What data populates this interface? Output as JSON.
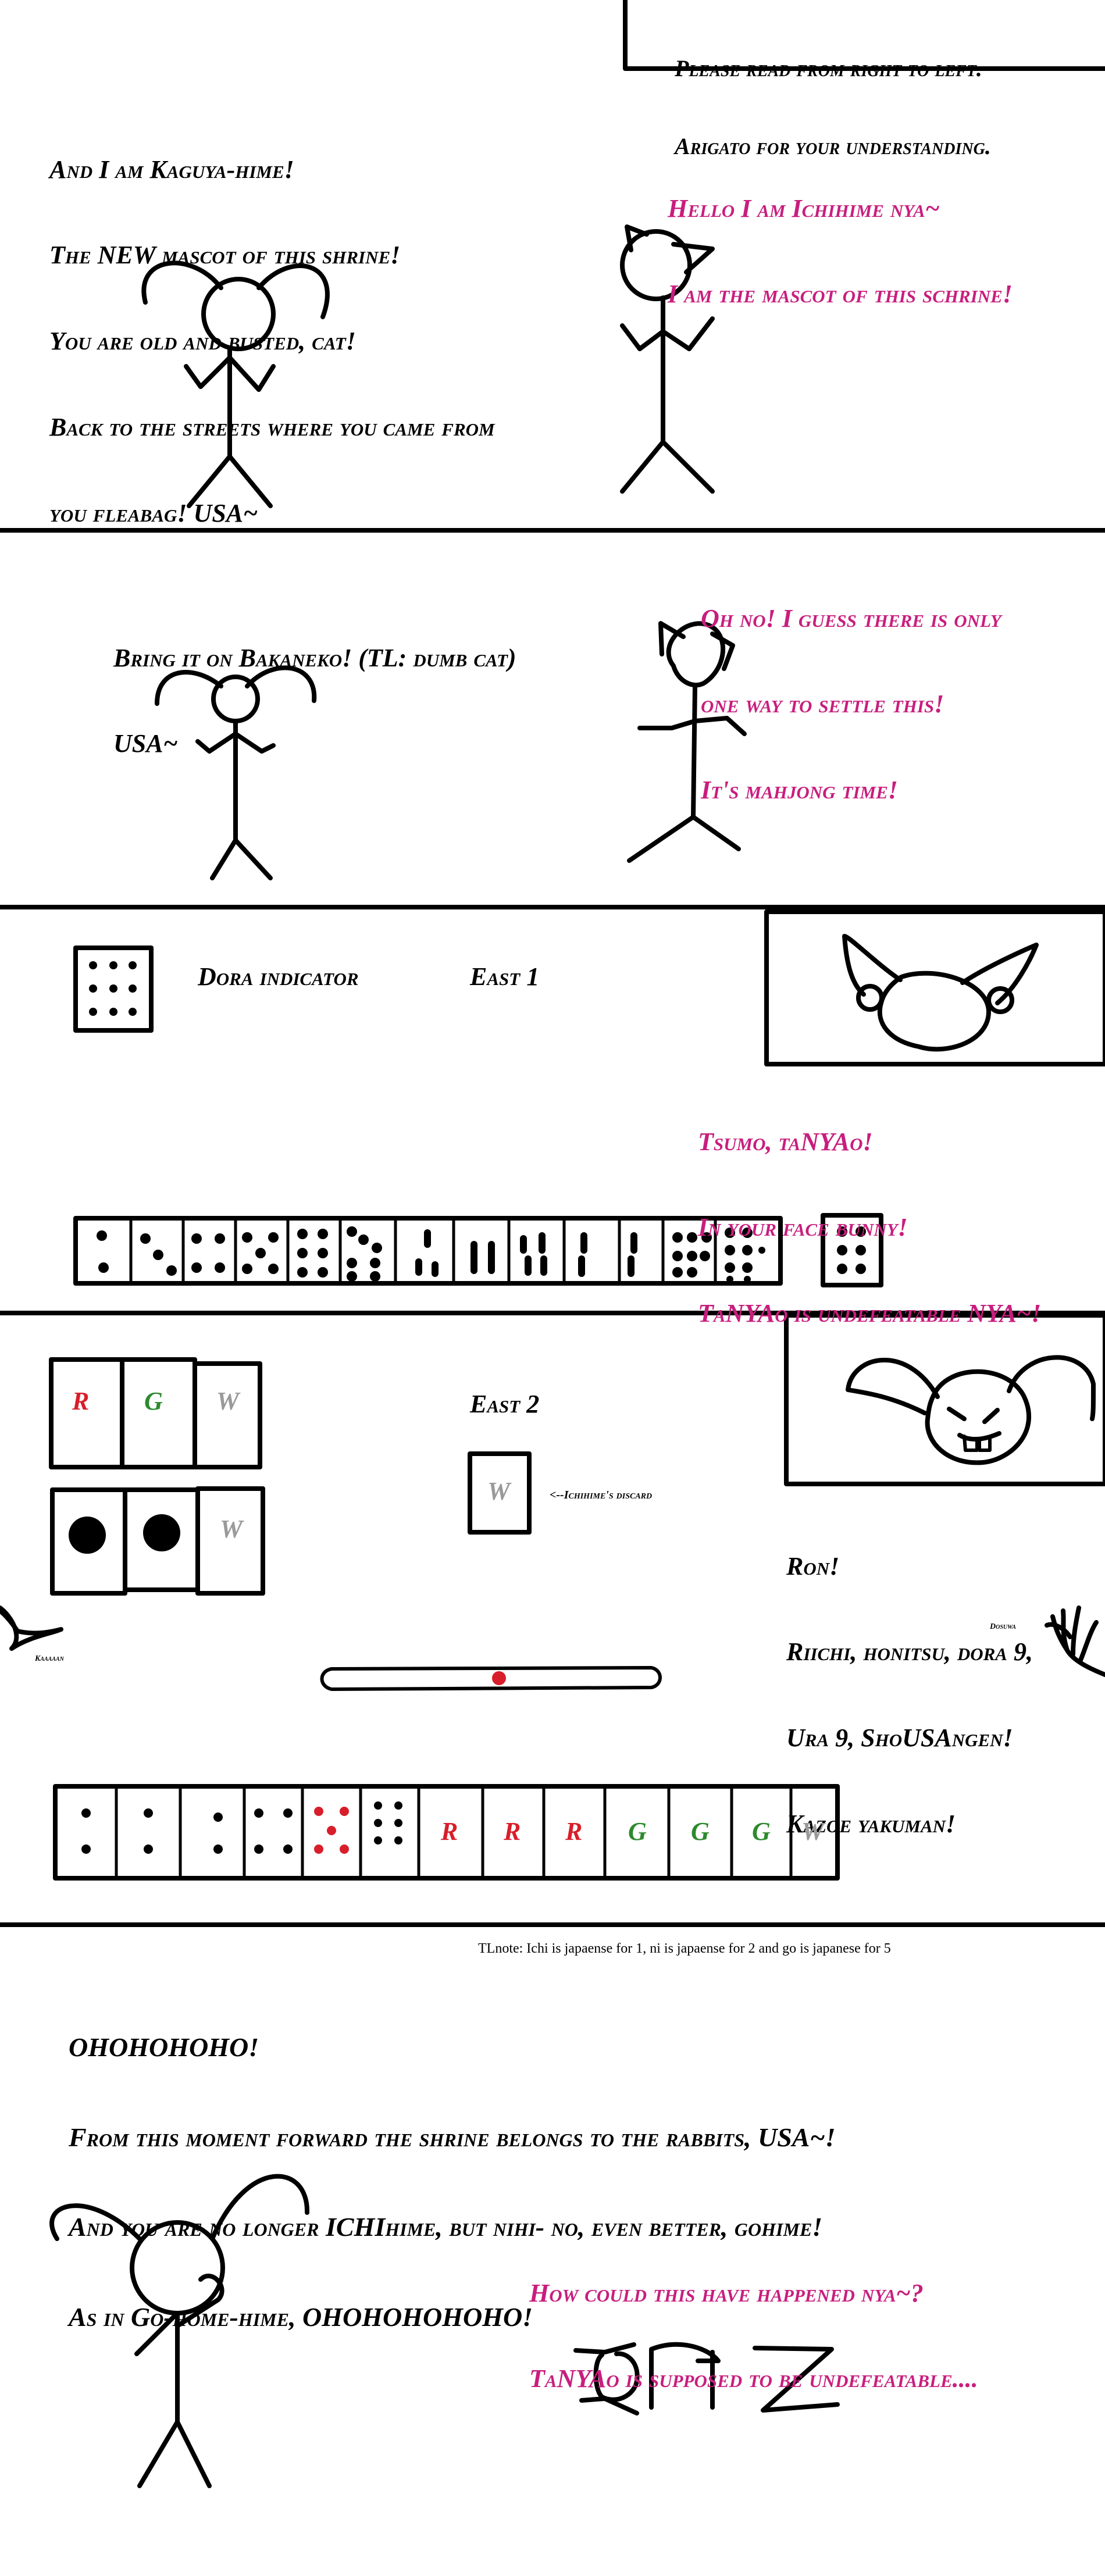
{
  "colors": {
    "ichihime": "#c81e7e",
    "red_tile": "#d81e2a",
    "green_tile": "#2d8a2d",
    "white_tile": "#9a9a9a"
  },
  "note": {
    "line1": "Please read from right to left.",
    "line2": "Arigato for your understanding."
  },
  "panel1": {
    "ichihime": [
      "Hello I am Ichihime nya~",
      "I am the mascot of this schrine!"
    ],
    "kaguya": [
      "And I am Kaguya-hime!",
      "The NEW mascot of this shrine!",
      "You are old and busted, cat!",
      "Back to the streets where you came from",
      "you fleabag! USA~"
    ]
  },
  "panel2": {
    "ichihime": [
      "Oh no! I guess there is only",
      "one way to settle this!",
      "It's mahjong time!"
    ],
    "kaguya": [
      "Bring it on Bakaneko! (TL: dumb cat)",
      "USA~"
    ]
  },
  "panel3": {
    "dora_label": "Dora indicator",
    "round": "East 1",
    "ichihime": [
      "Tsumo, taNYAo!",
      "In your face bunny!",
      "TaNYAo is undefeatable NYA~!"
    ]
  },
  "panel4": {
    "round": "East 2",
    "tiles_top": [
      "R",
      "G",
      "W"
    ],
    "tiles_mid": [
      "W"
    ],
    "discard_tile": "W",
    "discard_label": "<--Ichihime's discard",
    "kaguya": [
      "Ron!",
      "Riichi, honitsu, dora 9,",
      "Ura 9, ShoUSAngen!",
      "Kazoe yakuman!"
    ],
    "left_sfx": "Kaaaaan",
    "right_sfx": "Dosuwa",
    "hand_tiles": [
      "R",
      "R",
      "R",
      "G",
      "G",
      "G",
      "W"
    ]
  },
  "panel5": {
    "tl_note": "TLnote: Ichi is japaense for 1, ni is japaense for 2 and go is japanese for 5",
    "kaguya": [
      "OHOHOHOHO!",
      "From this moment forward the shrine belongs to the rabbits, USA~!",
      "And you are no longer ICHIhime, but nihi- no, even better, gohime!",
      "As in Go-home-hime, OHOHOHOHOHO!"
    ],
    "ichihime": [
      "How could this have happened nya~?",
      "TaNYAo is supposed to be undefeatable...."
    ]
  }
}
